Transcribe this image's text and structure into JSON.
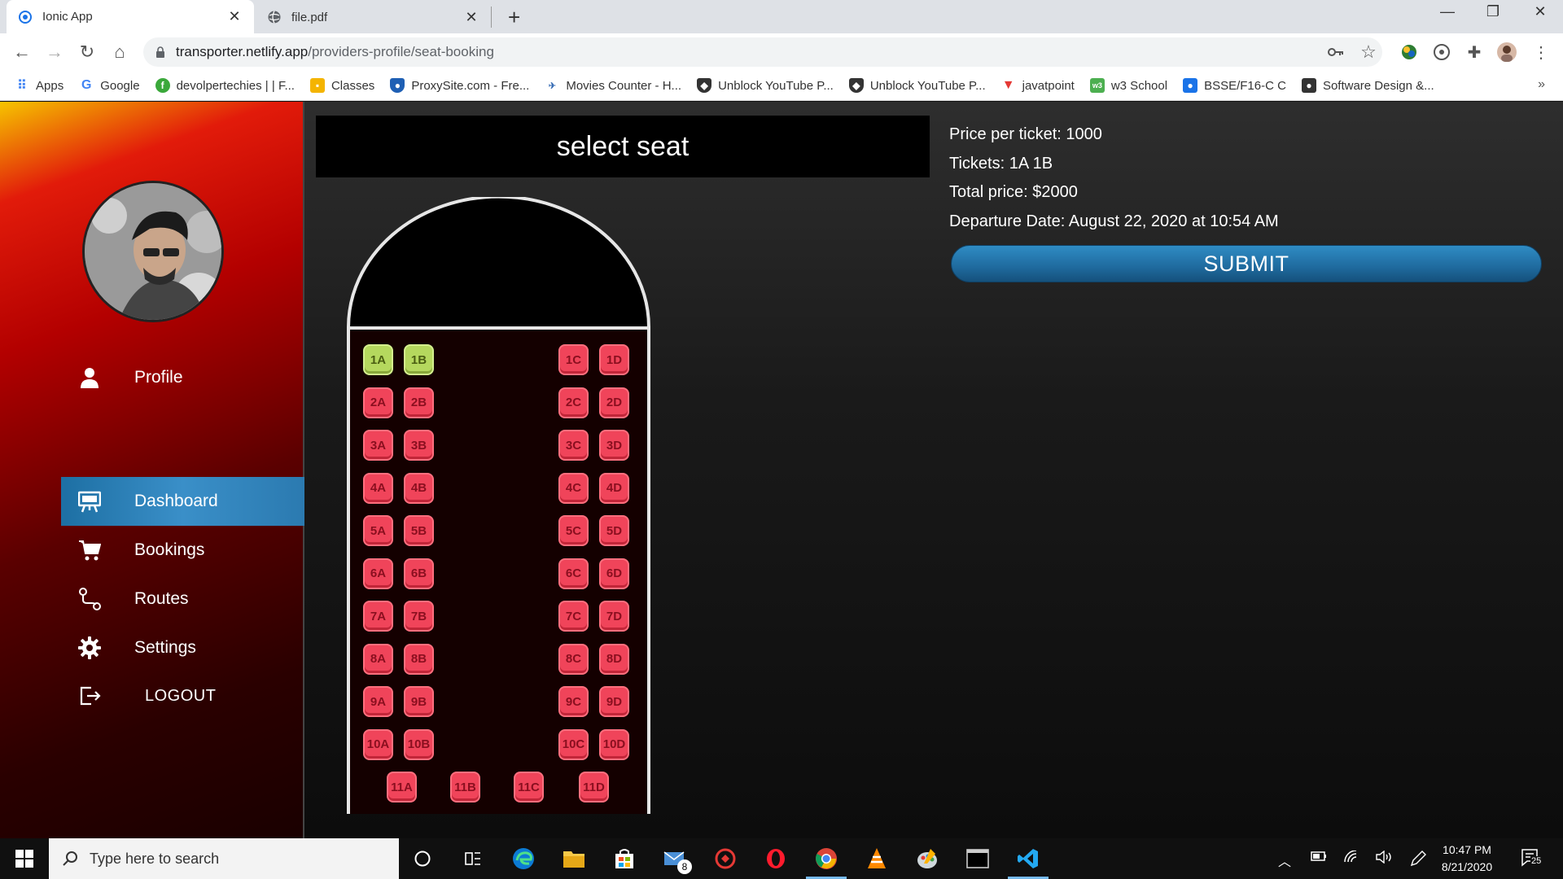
{
  "browser": {
    "tabs": [
      {
        "title": "Ionic App",
        "active": true
      },
      {
        "title": "file.pdf",
        "active": false
      }
    ],
    "url_host": "transporter.netlify.app",
    "url_path": "/providers-profile/seat-booking",
    "bookmarks": [
      {
        "label": "Apps",
        "icon": "apps-grid-icon"
      },
      {
        "label": "Google",
        "icon": "google-icon"
      },
      {
        "label": "devolpertechies | | F...",
        "icon": "green-circle-icon"
      },
      {
        "label": "Classes",
        "icon": "classroom-icon"
      },
      {
        "label": "ProxySite.com - Fre...",
        "icon": "shield-icon"
      },
      {
        "label": "Movies Counter - H...",
        "icon": "movies-icon"
      },
      {
        "label": "Unblock YouTube P...",
        "icon": "shield-icon"
      },
      {
        "label": "Unblock YouTube P...",
        "icon": "shield-icon"
      },
      {
        "label": "javatpoint",
        "icon": "javatpoint-icon"
      },
      {
        "label": "w3 School",
        "icon": "w3-icon"
      },
      {
        "label": "BSSE/F16-C C",
        "icon": "user-card-icon"
      },
      {
        "label": "Software Design &...",
        "icon": "user-card-icon"
      }
    ]
  },
  "sidebar": {
    "items": [
      {
        "label": "Profile",
        "icon": "person-icon",
        "active": false
      },
      {
        "label": "Dashboard",
        "icon": "easel-icon",
        "active": true
      },
      {
        "label": "Bookings",
        "icon": "cart-icon",
        "active": false
      },
      {
        "label": "Routes",
        "icon": "routes-icon",
        "active": false
      },
      {
        "label": "Settings",
        "icon": "gear-icon",
        "active": false
      }
    ],
    "logout_label": "LOGOUT"
  },
  "seat_header": "select seat",
  "seats": {
    "selected": [
      "1A",
      "1B"
    ],
    "rows": [
      [
        "1A",
        "1B",
        "1C",
        "1D"
      ],
      [
        "2A",
        "2B",
        "2C",
        "2D"
      ],
      [
        "3A",
        "3B",
        "3C",
        "3D"
      ],
      [
        "4A",
        "4B",
        "4C",
        "4D"
      ],
      [
        "5A",
        "5B",
        "5C",
        "5D"
      ],
      [
        "6A",
        "6B",
        "6C",
        "6D"
      ],
      [
        "7A",
        "7B",
        "7C",
        "7D"
      ],
      [
        "8A",
        "8B",
        "8C",
        "8D"
      ],
      [
        "9A",
        "9B",
        "9C",
        "9D"
      ],
      [
        "10A",
        "10B",
        "10C",
        "10D"
      ]
    ],
    "back_row": [
      "11A",
      "11B",
      "11C",
      "11D"
    ]
  },
  "info": {
    "price": "Price per ticket: 1000",
    "tickets": "Tickets: 1A 1B",
    "total": "Total price: $2000",
    "departure": "Departure Date: August 22, 2020 at 10:54 AM"
  },
  "submit_label": "SUBMIT",
  "taskbar": {
    "search_placeholder": "Type here to search",
    "mail_badge": "8",
    "time": "10:47 PM",
    "date": "8/21/2020",
    "notification_count": "25"
  }
}
